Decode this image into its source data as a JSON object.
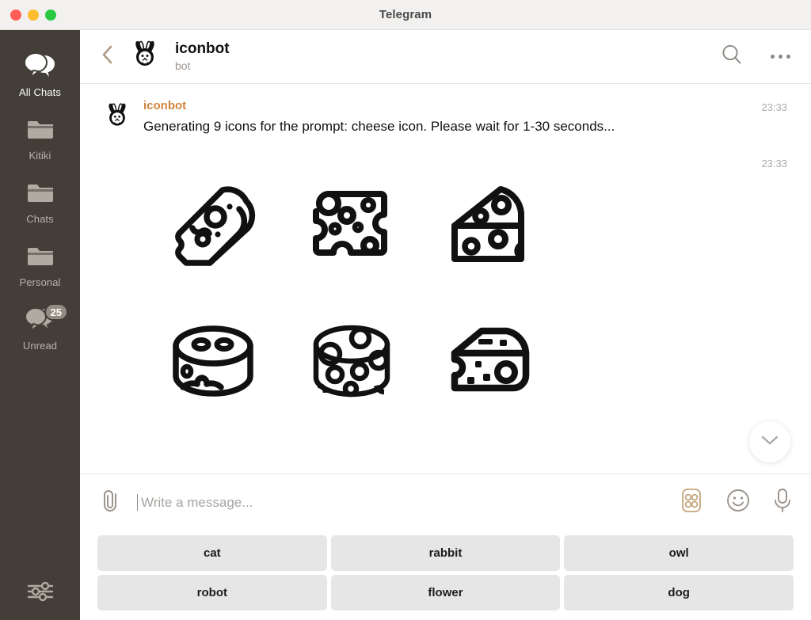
{
  "window": {
    "title": "Telegram",
    "traffic_lights": [
      "close",
      "minimize",
      "zoom"
    ]
  },
  "sidebar": {
    "items": [
      {
        "label": "All Chats",
        "icon": "chats-icon",
        "active": true,
        "badge": null
      },
      {
        "label": "Kitiki",
        "icon": "folder-icon",
        "active": false,
        "badge": null
      },
      {
        "label": "Chats",
        "icon": "folder-icon",
        "active": false,
        "badge": null
      },
      {
        "label": "Personal",
        "icon": "folder-icon",
        "active": false,
        "badge": null
      },
      {
        "label": "Unread",
        "icon": "chat-bubble-icon",
        "active": false,
        "badge": "25"
      }
    ],
    "settings_icon": "sliders-icon",
    "background_color": "#433e38"
  },
  "chat_header": {
    "back_icon": "chevron-left-icon",
    "avatar_icon": "rabbit-avatar",
    "title": "iconbot",
    "subtitle": "bot",
    "search_icon": "search-icon",
    "menu_icon": "more-options-icon"
  },
  "conversation": {
    "messages": [
      {
        "author": "iconbot",
        "author_color": "#d2833c",
        "text": "Generating 9 icons for the prompt: cheese icon. Please wait for 1-30 seconds...",
        "time": "23:33"
      },
      {
        "author": "",
        "text": "",
        "time": "23:33",
        "attachment": "icon-grid"
      }
    ],
    "icon_grid": [
      {
        "name": "cheese-wedge-angled-icon"
      },
      {
        "name": "cheese-block-square-icon"
      },
      {
        "name": "cheese-wedge-sloped-icon"
      },
      {
        "name": "cheese-wheel-icon"
      },
      {
        "name": "cheese-round-holes-icon"
      },
      {
        "name": "cheese-wedge-flat-icon"
      }
    ],
    "scroll_down_icon": "chevron-down-icon"
  },
  "compose": {
    "attach_icon": "paperclip-icon",
    "placeholder": "Write a message...",
    "value": "",
    "bot_commands_icon": "bot-commands-icon",
    "bot_commands_color": "#c4a57b",
    "emoji_icon": "smiley-icon",
    "mic_icon": "microphone-icon"
  },
  "keyboard": {
    "buttons": [
      "cat",
      "rabbit",
      "owl",
      "robot",
      "flower",
      "dog"
    ]
  }
}
